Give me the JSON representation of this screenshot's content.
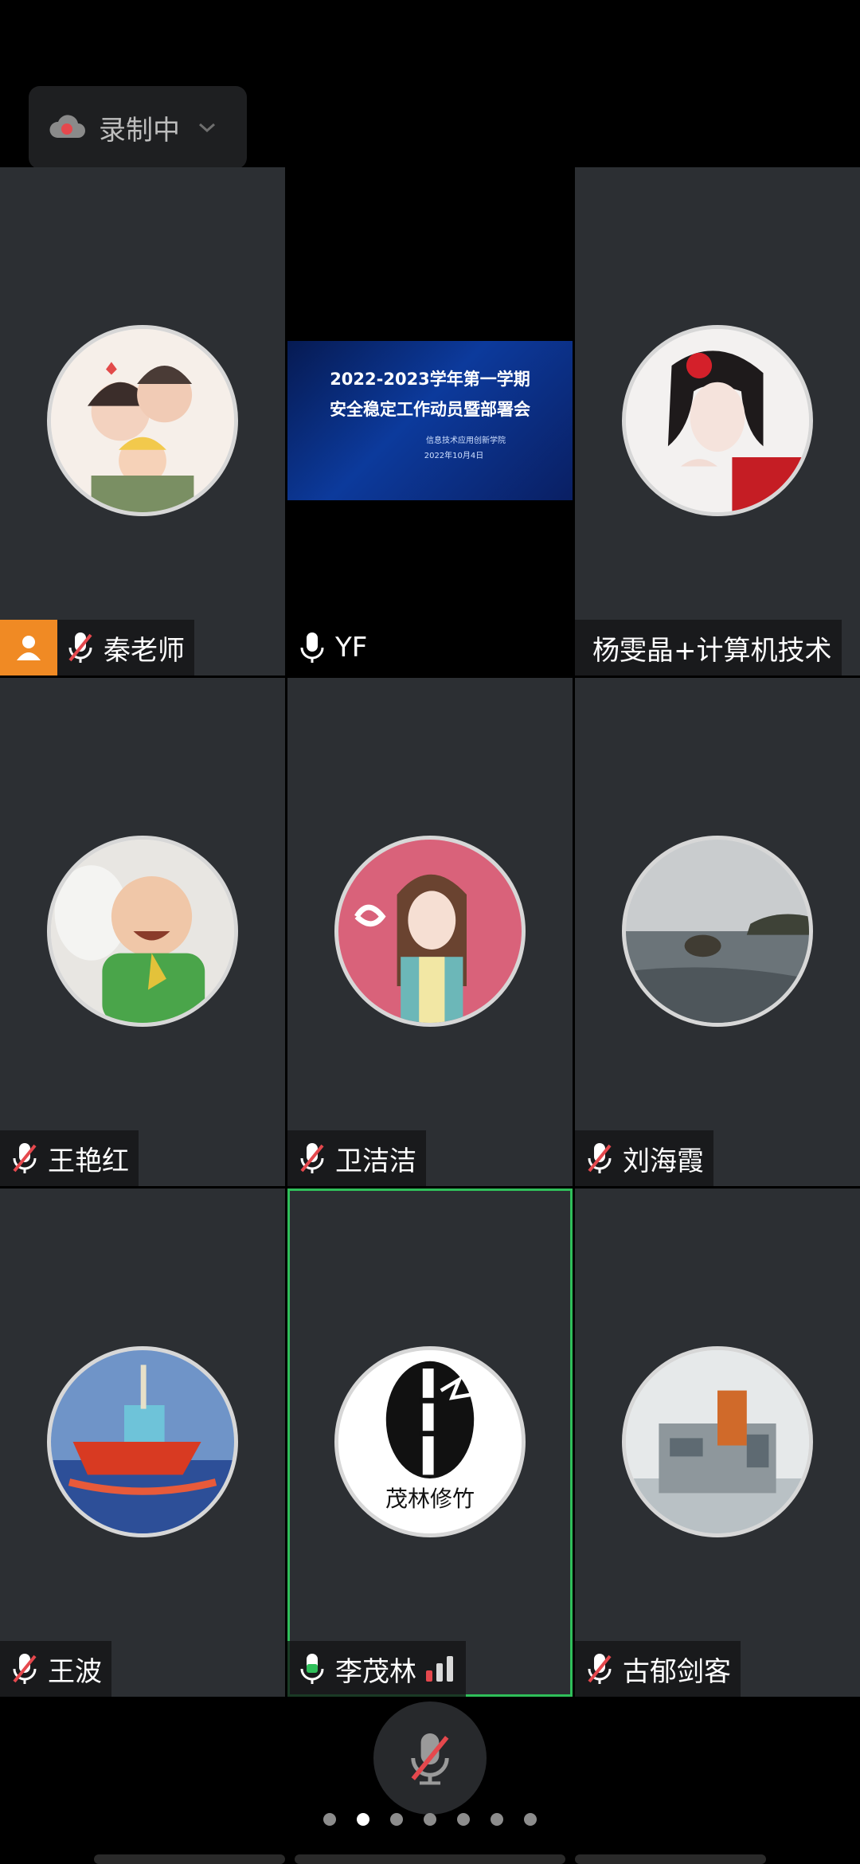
{
  "recording": {
    "label": "录制中"
  },
  "participants": [
    {
      "name": "秦老师",
      "muted": true,
      "host": true
    },
    {
      "name": "YF",
      "muted": false,
      "sharing": true
    },
    {
      "name": "杨雯晶+计算机技术",
      "muted": null
    },
    {
      "name": "王艳红",
      "muted": true
    },
    {
      "name": "卫洁洁",
      "muted": true
    },
    {
      "name": "刘海霞",
      "muted": true
    },
    {
      "name": "王波",
      "muted": true
    },
    {
      "name": "李茂林",
      "muted": false,
      "speaking": true,
      "active": true
    },
    {
      "name": "古郁剑客",
      "muted": true
    }
  ],
  "shared_screen": {
    "title_line1": "2022-2023学年第一学期",
    "title_line2": "安全稳定工作动员暨部署会",
    "org": "信息技术应用创新学院",
    "date": "2022年10月4日"
  },
  "avatar_text": {
    "bamboo": "茂林修竹"
  },
  "pager": {
    "count": 7,
    "current": 2
  },
  "colors": {
    "accent_green": "#2fbf5a",
    "host_orange": "#f08a24",
    "mute_red": "#e5484d",
    "tile_bg": "#2c2f33"
  }
}
